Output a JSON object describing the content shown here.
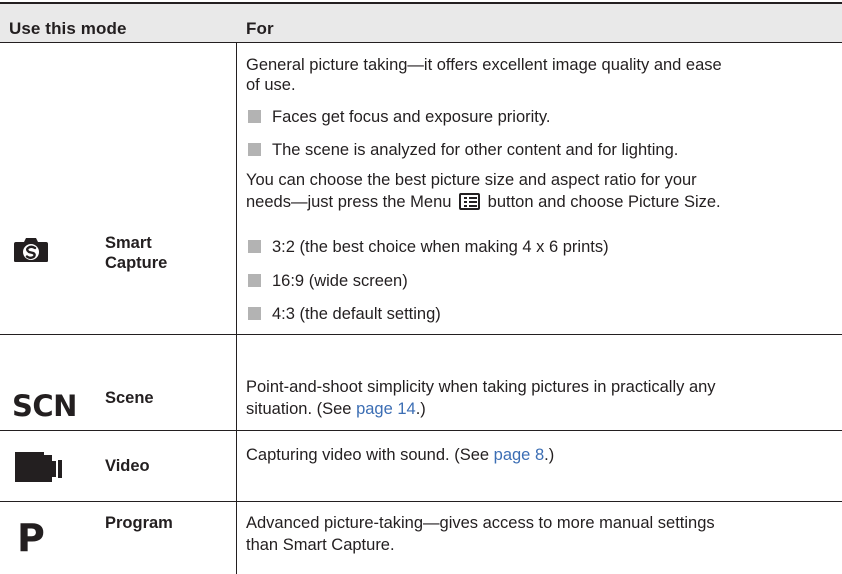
{
  "header": {
    "col1": "Use this mode",
    "col2": "For"
  },
  "modes": {
    "smart": {
      "icon": "smart-capture-camera-icon",
      "name_line1": "Smart",
      "name_line2": "Capture",
      "desc_line1": "General picture taking—it offers excellent image quality and ease",
      "desc_line2": "of use.",
      "bullet1": "Faces get focus and exposure priority.",
      "bullet2": "The scene is analyzed for other content and for lighting.",
      "para_line1": "You can choose the best picture size and aspect ratio for your",
      "para_line2a": "needs—just press the Menu",
      "para_line2b": "button and choose Picture Size.",
      "bullet3": "3:2 (the best choice when making 4 x 6 prints)",
      "bullet4": "16:9 (wide screen)",
      "bullet5": "4:3 (the default setting)"
    },
    "scene": {
      "icon_text": "SCN",
      "name": "Scene",
      "desc_line1": "Point-and-shoot simplicity when taking pictures in practically any",
      "desc_line2a": "situation. (See ",
      "link": "page 14",
      "desc_line2b": ".)"
    },
    "video": {
      "icon": "video-camera-icon",
      "name": "Video",
      "desc_a": "Capturing video with sound. (See ",
      "link": "page 8",
      "desc_b": ".)"
    },
    "program": {
      "icon_text": "P",
      "name": "Program",
      "desc_line1": "Advanced picture-taking—gives access to more manual settings",
      "desc_line2": "than Smart Capture."
    }
  },
  "colors": {
    "link": "#3c6eb4",
    "header_bg": "#e9e9e9",
    "bullet": "#b3b3b3"
  }
}
